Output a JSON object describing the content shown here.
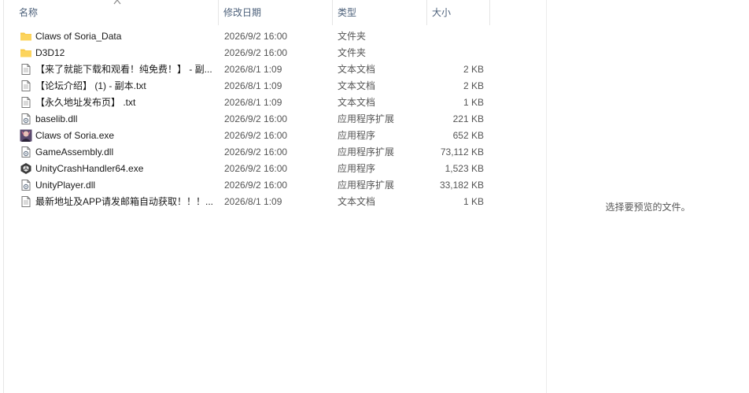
{
  "columns": {
    "name": "名称",
    "date": "修改日期",
    "type": "类型",
    "size": "大小"
  },
  "files": [
    {
      "icon": "folder-icon",
      "name": "Claws of Soria_Data",
      "date": "2026/9/2 16:00",
      "type": "文件夹",
      "size": ""
    },
    {
      "icon": "folder-icon",
      "name": "D3D12",
      "date": "2026/9/2 16:00",
      "type": "文件夹",
      "size": ""
    },
    {
      "icon": "text-file-icon",
      "name": "【来了就能下载和观看！纯免费！】 - 副...",
      "date": "2026/8/1 1:09",
      "type": "文本文档",
      "size": "2 KB"
    },
    {
      "icon": "text-file-icon",
      "name": "【论坛介绍】 (1) - 副本.txt",
      "date": "2026/8/1 1:09",
      "type": "文本文档",
      "size": "2 KB"
    },
    {
      "icon": "text-file-icon",
      "name": "【永久地址发布页】 .txt",
      "date": "2026/8/1 1:09",
      "type": "文本文档",
      "size": "1 KB"
    },
    {
      "icon": "dll-file-icon",
      "name": "baselib.dll",
      "date": "2026/9/2 16:00",
      "type": "应用程序扩展",
      "size": "221 KB"
    },
    {
      "icon": "game-app-icon",
      "name": "Claws of Soria.exe",
      "date": "2026/9/2 16:00",
      "type": "应用程序",
      "size": "652 KB"
    },
    {
      "icon": "dll-file-icon",
      "name": "GameAssembly.dll",
      "date": "2026/9/2 16:00",
      "type": "应用程序扩展",
      "size": "73,112 KB"
    },
    {
      "icon": "unity-app-icon",
      "name": "UnityCrashHandler64.exe",
      "date": "2026/9/2 16:00",
      "type": "应用程序",
      "size": "1,523 KB"
    },
    {
      "icon": "dll-file-icon",
      "name": "UnityPlayer.dll",
      "date": "2026/9/2 16:00",
      "type": "应用程序扩展",
      "size": "33,182 KB"
    },
    {
      "icon": "text-file-icon",
      "name": "最新地址及APP请发邮箱自动获取！！！...",
      "date": "2026/8/1 1:09",
      "type": "文本文档",
      "size": "1 KB"
    }
  ],
  "preview": {
    "message": "选择要预览的文件。"
  }
}
